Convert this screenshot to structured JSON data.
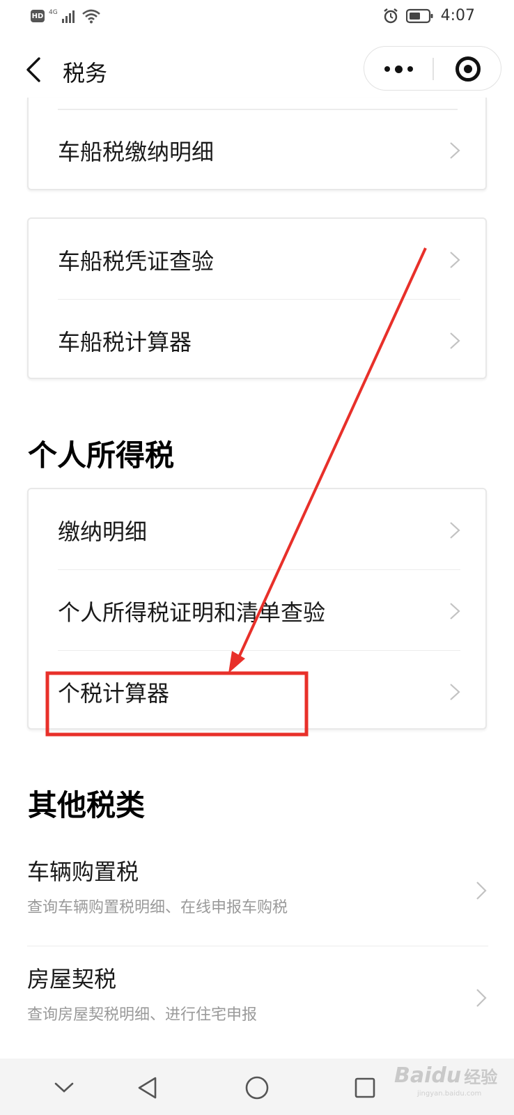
{
  "status_bar": {
    "hd": "HD",
    "network": "4G",
    "time": "4:07"
  },
  "nav": {
    "title": "税务"
  },
  "card_top": {
    "items": [
      {
        "label": "车船税缴纳明细"
      }
    ]
  },
  "card_vessel": {
    "items": [
      {
        "label": "车船税凭证查验"
      },
      {
        "label": "车船税计算器"
      }
    ]
  },
  "section_personal": {
    "title": "个人所得税",
    "items": [
      {
        "label": "缴纳明细"
      },
      {
        "label": "个人所得税证明和清单查验"
      },
      {
        "label": "个税计算器"
      }
    ]
  },
  "section_other": {
    "title": "其他税类",
    "items": [
      {
        "title": "车辆购置税",
        "subtitle": "查询车辆购置税明细、在线申报车购税"
      },
      {
        "title": "房屋契税",
        "subtitle": "查询房屋契税明细、进行住宅申报"
      }
    ]
  },
  "annotation": {
    "highlight_color": "#e8302a",
    "highlight_target": "个税计算器"
  },
  "watermark": {
    "brand": "Baidu",
    "suffix": "经验",
    "url": "jingyan.baidu.com"
  },
  "icons": {
    "back": "chevron-left-icon",
    "more": "more-dots-icon",
    "close": "target-circle-icon",
    "row_arrow": "chevron-right-icon",
    "system_nav": [
      "collapse-down-icon",
      "back-triangle-icon",
      "home-circle-icon",
      "recent-square-icon"
    ]
  }
}
